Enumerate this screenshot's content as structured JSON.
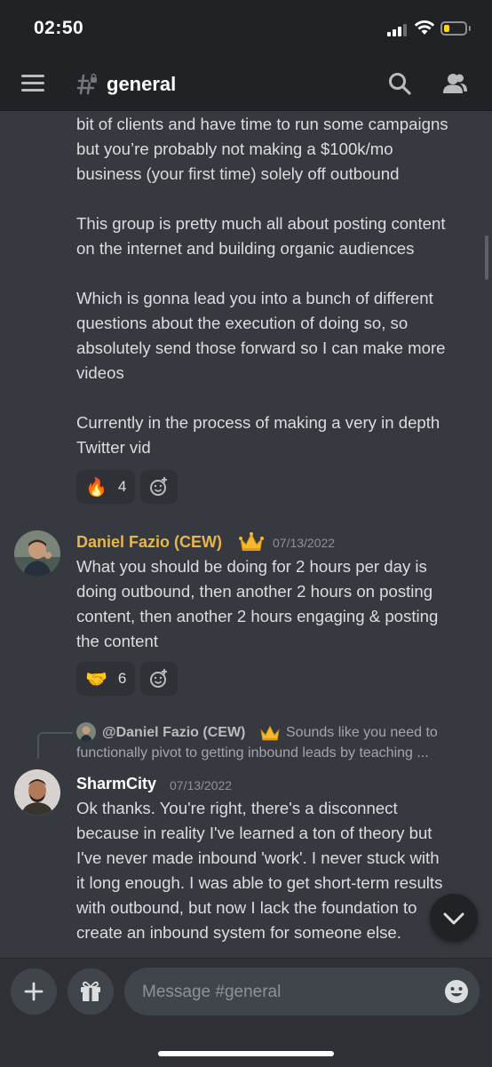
{
  "status_bar": {
    "time": "02:50"
  },
  "header": {
    "channel_name": "general"
  },
  "messages": {
    "first": {
      "text": "bit of clients and have time to run some campaigns\nbut you’re probably not making a $100k/mo\nbusiness (your first time) solely off outbound\n\nThis group is pretty much all about posting content\non the internet and building organic audiences\n\nWhich is gonna lead you into a bunch of different\nquestions about the execution of doing so, so\nabsolutely send those forward so I can make more\nvideos\n\nCurrently in the process of making a very in depth\nTwitter vid",
      "reaction": {
        "emoji": "🔥",
        "count": "4"
      }
    },
    "second": {
      "author": "Daniel Fazio (CEW)",
      "author_color": "#e8b54d",
      "timestamp": "07/13/2022",
      "text": "What you should be doing for 2 hours per day is\ndoing outbound, then another 2 hours on posting\ncontent, then another 2 hours engaging & posting\nthe content",
      "reaction": {
        "emoji": "🤝",
        "count": "6"
      }
    },
    "third": {
      "reply_to_name": "@Daniel Fazio (CEW)",
      "reply_preview_line1": "Sounds like you need to",
      "reply_preview_line2": "functionally pivot to getting inbound leads by teaching ...",
      "author": "SharmCity",
      "author_color": "#ffffff",
      "timestamp": "07/13/2022",
      "text": "Ok thanks. You're right, there's a disconnect\nbecause in reality I've learned a ton of theory but\nI've never made inbound 'work'. I never stuck with\nit long enough. I was able to get short-term results\nwith outbound, but now I lack the foundation to\ncreate an inbound system for someone else."
    }
  },
  "composer": {
    "placeholder": "Message #general"
  },
  "colors": {
    "background": "#36393f",
    "header": "#202225",
    "text": "#dcddde",
    "admin_name": "#e8b54d"
  },
  "icons": [
    "hamburger-icon",
    "channel-hash-icon",
    "search-icon",
    "members-icon",
    "add-reaction-icon",
    "chevron-down-icon",
    "plus-icon",
    "gift-icon",
    "emoji-icon",
    "crown-icon"
  ]
}
